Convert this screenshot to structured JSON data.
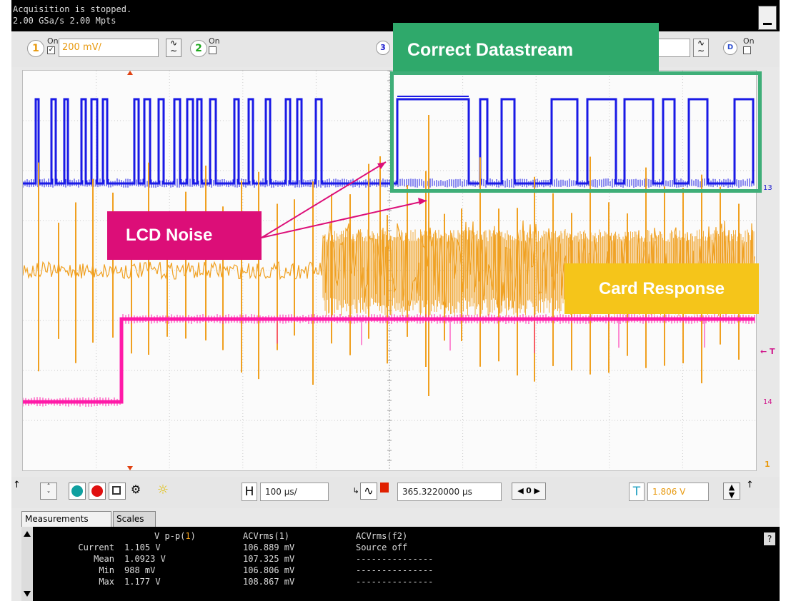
{
  "status": {
    "line1": "Acquisition is stopped.",
    "line2": "2.00 GSa/s   2.00 Mpts"
  },
  "channels": [
    {
      "num": "1",
      "on_label": "On",
      "checked": true,
      "scale": "200 mV/",
      "color": "#f0a020"
    },
    {
      "num": "2",
      "on_label": "On",
      "checked": false,
      "color": "#30c030"
    },
    {
      "num": "3",
      "color": "#2020e0"
    },
    {
      "num": "D",
      "on_label": "On",
      "checked": false,
      "color": "#3050d0"
    }
  ],
  "annotations": {
    "datastream": "Correct Datastream",
    "lcd": "LCD Noise",
    "card": "Card Response"
  },
  "markers": {
    "ch3": "13",
    "trigger": "T",
    "ch4": "14",
    "bottom": "1"
  },
  "toolbar": {
    "horizontal_label": "H",
    "horizontal_scale": "100 µs/",
    "delay": "365.3220000 µs",
    "nav_value": "0",
    "trigger_label": "T",
    "trigger_level": "1.806 V"
  },
  "tabs": [
    "Measurements",
    "Scales"
  ],
  "measurements": {
    "columns": [
      "V p-p(1)",
      "ACVrms(1)",
      "ACVrms(f2)"
    ],
    "rows": [
      {
        "label": "Current",
        "values": [
          "1.105 V",
          "106.889 mV",
          "Source off"
        ]
      },
      {
        "label": "Mean",
        "values": [
          "1.0923 V",
          "107.325 mV",
          "---------------"
        ]
      },
      {
        "label": "Min",
        "values": [
          "988 mV",
          "106.806 mV",
          "---------------"
        ]
      },
      {
        "label": "Max",
        "values": [
          "1.177 V",
          "108.867 mV",
          "---------------"
        ]
      }
    ],
    "help": "?"
  },
  "colors": {
    "ch1": "#f0a020",
    "ch3": "#1a1ae6",
    "ch4": "#ff1aa8",
    "datastream": "#2fa96b",
    "lcd": "#dc0e78",
    "card": "#f5c51a"
  }
}
